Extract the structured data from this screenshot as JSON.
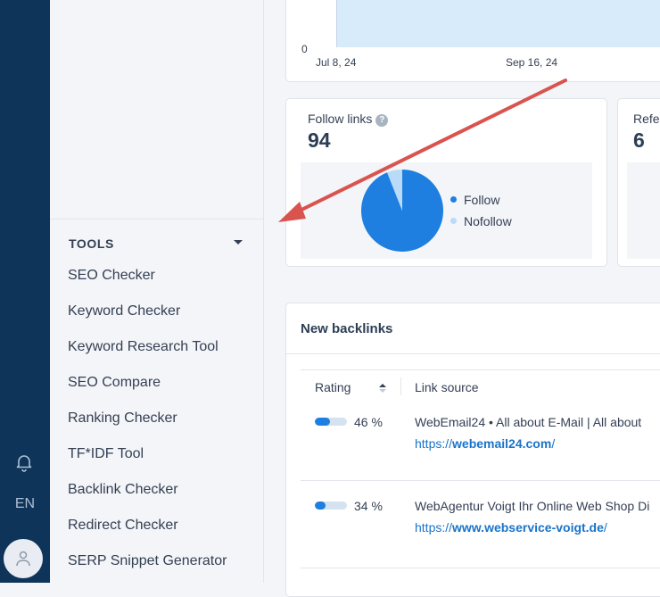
{
  "rail": {
    "language": "EN"
  },
  "sidebar": {
    "section_title": "TOOLS",
    "items": [
      {
        "label": "SEO Checker"
      },
      {
        "label": "Keyword Checker"
      },
      {
        "label": "Keyword Research Tool"
      },
      {
        "label": "SEO Compare"
      },
      {
        "label": "Ranking Checker"
      },
      {
        "label": "TF*IDF Tool"
      },
      {
        "label": "Backlink Checker"
      },
      {
        "label": "Redirect Checker"
      },
      {
        "label": "SERP Snippet Generator"
      }
    ]
  },
  "top_chart": {
    "chart_data": {
      "type": "area",
      "x_ticks": [
        "Jul 8, 24",
        "Sep 16, 24"
      ],
      "y_ticks": [
        "0"
      ]
    }
  },
  "follow_card": {
    "title": "Follow links",
    "help": "?",
    "value": "94",
    "chart_data": {
      "type": "pie",
      "series": [
        {
          "name": "Follow",
          "value": 94,
          "color": "#1e7fe0"
        },
        {
          "name": "Nofollow",
          "value": 6,
          "color": "#b9dbf8"
        }
      ]
    }
  },
  "ref_card": {
    "title": "Refe",
    "value": "6"
  },
  "backlinks": {
    "title": "New backlinks",
    "columns": [
      "Rating",
      "Link source"
    ],
    "rows": [
      {
        "rating": 0.46,
        "rating_label": "46 %",
        "title": "WebEmail24 • All about E-Mail | All about",
        "url_prefix": "https://",
        "url_domain": "webemail24.com",
        "url_suffix": "/"
      },
      {
        "rating": 0.34,
        "rating_label": "34 %",
        "title": "WebAgentur Voigt Ihr Online Web Shop Di",
        "url_prefix": "https://",
        "url_domain": "www.webservice-voigt.de",
        "url_suffix": "/"
      }
    ]
  },
  "colors": {
    "rail": "#0f3459",
    "accent": "#1e7fe0",
    "arrow": "#d9534f"
  }
}
